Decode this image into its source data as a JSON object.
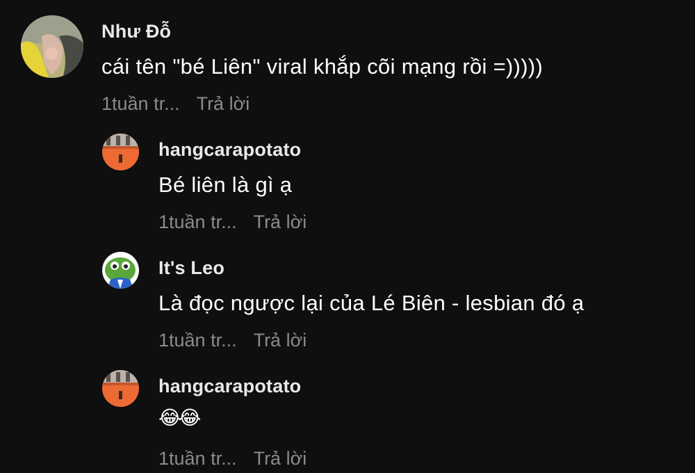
{
  "comments": [
    {
      "username": "Như Đỗ",
      "text": "cái tên \"bé Liên\" viral khắp cõi mạng rồi =)))))",
      "time": "1tuần tr...",
      "reply_label": "Trả lời"
    },
    {
      "username": "hangcarapotato",
      "text": "Bé liên là gì ạ",
      "time": "1tuần tr...",
      "reply_label": "Trả lời"
    },
    {
      "username": "It's Leo",
      "text": "Là đọc ngược lại của Lé Biên - lesbian đó ạ",
      "time": "1tuần tr...",
      "reply_label": "Trả lời"
    },
    {
      "username": "hangcarapotato",
      "text": "😂😂",
      "time": "1tuần tr...",
      "reply_label": "Trả lời"
    }
  ],
  "colors": {
    "background": "#0f0f0f",
    "text": "#ffffff",
    "meta": "#8b8b8b"
  }
}
